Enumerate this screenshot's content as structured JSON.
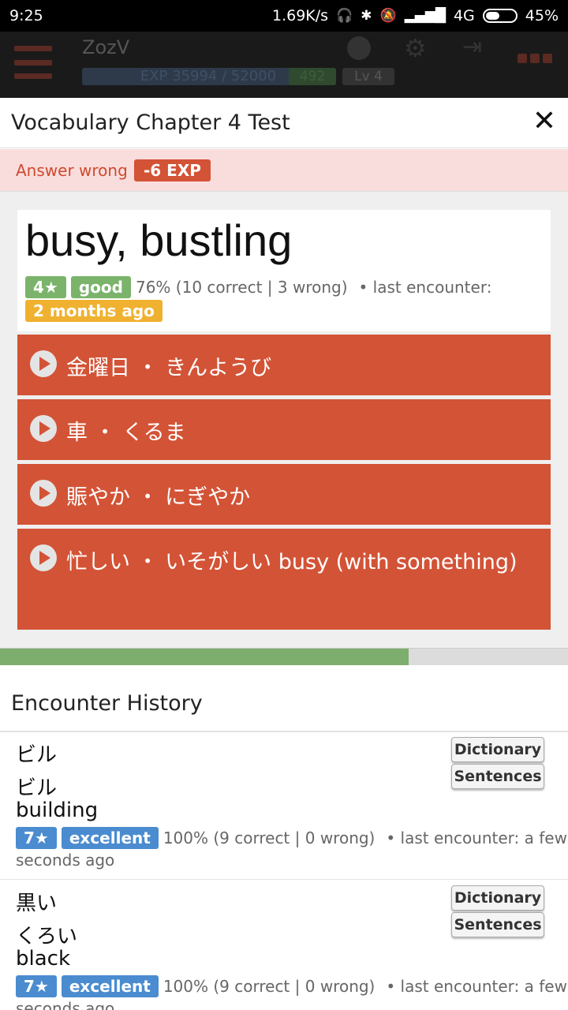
{
  "status_bar": {
    "time": "9:25",
    "speed": "1.69K/s",
    "network": "4G",
    "battery": "45%"
  },
  "app_header": {
    "user": "ZozV",
    "exp": "EXP 35994 / 52000",
    "points": "492",
    "level": "Lv 4"
  },
  "modal": {
    "title": "Vocabulary Chapter 4 Test",
    "close_label": "✕"
  },
  "alert": {
    "text": "Answer wrong",
    "exp_change": "-6 EXP"
  },
  "question": {
    "word": "busy, bustling",
    "stars": "4★",
    "rating": "good",
    "stats": "76% (10 correct | 3 wrong)",
    "last_encounter_label": "• last encounter:",
    "last_encounter_value": "2 months ago"
  },
  "answers": [
    {
      "text": "金曜日 ・ きんようび"
    },
    {
      "text": "車 ・ くるま"
    },
    {
      "text": "賑やか ・ にぎやか"
    },
    {
      "text": "忙しい ・ いそがしい   busy (with something)"
    }
  ],
  "progress": {
    "fraction": 0.72
  },
  "history": {
    "title": "Encounter History",
    "items": [
      {
        "kanji": "ビル",
        "reading": "ビル",
        "meaning": "building",
        "stars": "7★",
        "rating": "excellent",
        "stats": "100% (9 correct | 0 wrong)",
        "last_encounter": "• last encounter: a few",
        "last_encounter_cont": "seconds ago",
        "btn_dictionary": "Dictionary",
        "btn_sentences": "Sentences"
      },
      {
        "kanji": "黒い",
        "reading": "くろい",
        "meaning": "black",
        "stars": "7★",
        "rating": "excellent",
        "stats": "100% (9 correct | 0 wrong)",
        "last_encounter": "• last encounter: a few",
        "last_encounter_cont": "seconds ago",
        "btn_dictionary": "Dictionary",
        "btn_sentences": "Sentences"
      }
    ]
  }
}
